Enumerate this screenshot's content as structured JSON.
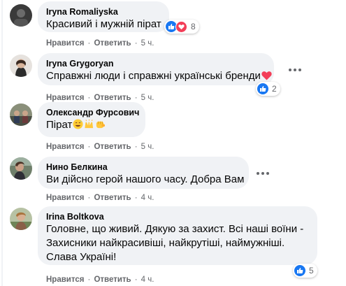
{
  "actions": {
    "like": "Нравится",
    "reply": "Ответить",
    "dot": "·"
  },
  "colors": {
    "like_blue": "#1877f2",
    "heart_red": "#f33e58",
    "bubble_bg": "#f0f2f5",
    "meta_gray": "#65676b"
  },
  "comments": [
    {
      "author": "Iryna Romaliyska",
      "text": "Красивий і мужній пірат",
      "time": "5 ч.",
      "reaction_icons": [
        "like-icon",
        "love-icon"
      ],
      "reaction_count": "8"
    },
    {
      "author": "Iryna Grygoryan",
      "text": "Справжні люди і справжні українські бренди",
      "time": "5 ч.",
      "reaction_icons": [
        "like-icon"
      ],
      "reaction_count": "2",
      "emoji": [
        "red-heart-emoji"
      ]
    },
    {
      "author": "Олександр Фурсович",
      "text": "Пірат",
      "time": "5 ч.",
      "emoji": [
        "grinning-sweat-emoji",
        "raising-hands-emoji",
        "fist-bump-emoji"
      ]
    },
    {
      "author": "Нино Белкина",
      "text": "Ви дійсно герой нашого часу. Добра Вам",
      "time": "4 ч."
    },
    {
      "author": "Irina Boltkova",
      "text_lines": [
        "Головне, що живий. Дякую за захист. Всі наші воїни -",
        "Захисники найкрасивіші, найкрутіші, наймужніші.",
        "Слава Україні!"
      ],
      "time": "4 ч.",
      "reaction_icons": [
        "like-icon"
      ],
      "reaction_count": "5"
    }
  ]
}
